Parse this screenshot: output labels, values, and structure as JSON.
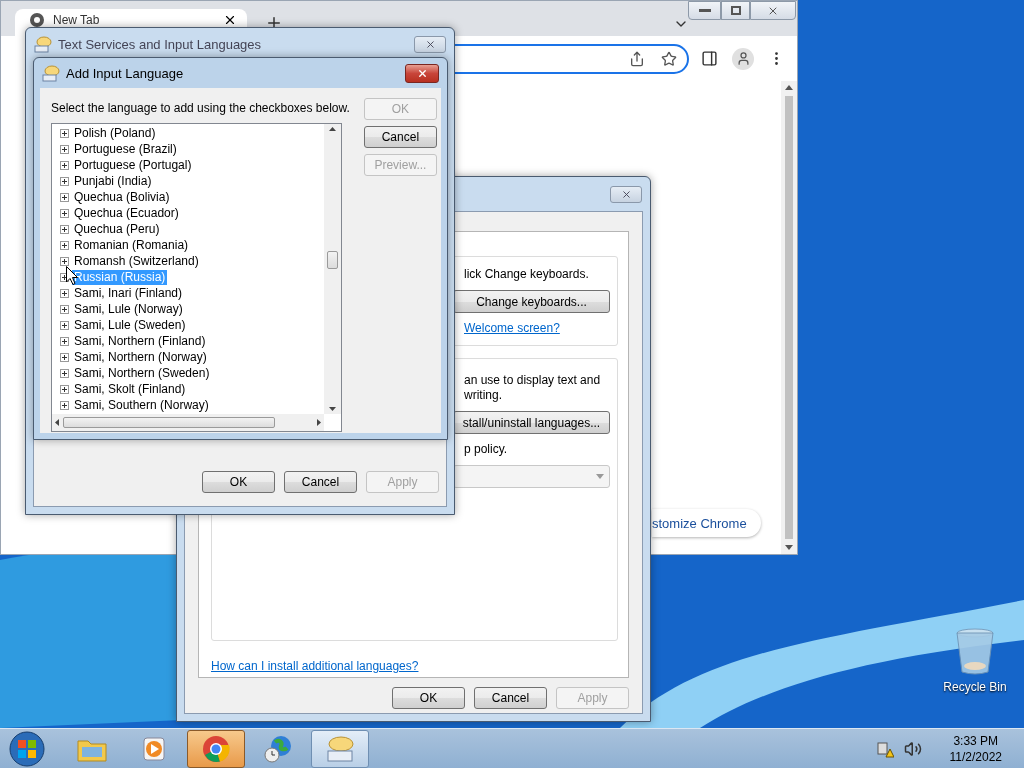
{
  "browser": {
    "tab": {
      "label": "New Tab",
      "selected": true
    },
    "customize_button": "stomize Chrome"
  },
  "language_dialog": {
    "keyboards_text": "lick Change keyboards.",
    "change_keyboards_button": "Change keyboards...",
    "welcome_link": "Welcome screen?",
    "display_text": "an use to display text and\nwriting.",
    "install_button": "stall/uninstall languages...",
    "policy_text": "p policy.",
    "help_link": "How can I install additional languages?",
    "buttons": [
      {
        "label": "OK",
        "disabled": false
      },
      {
        "label": "Cancel",
        "disabled": false
      },
      {
        "label": "Apply",
        "disabled": true
      }
    ]
  },
  "text_services_dialog": {
    "title": "Text Services and Input Languages",
    "buttons": [
      {
        "label": "OK",
        "disabled": false
      },
      {
        "label": "Cancel",
        "disabled": false
      },
      {
        "label": "Apply",
        "disabled": true
      }
    ]
  },
  "add_language_dialog": {
    "title": "Add Input Language",
    "instruction": "Select the language to add using the checkboxes below.",
    "buttons": [
      {
        "label": "OK",
        "disabled": true
      },
      {
        "label": "Cancel",
        "disabled": false
      },
      {
        "label": "Preview...",
        "disabled": true
      }
    ],
    "languages": [
      {
        "label": "Polish (Poland)",
        "selected": false,
        "expanded": false
      },
      {
        "label": "Portuguese (Brazil)",
        "selected": false,
        "expanded": false
      },
      {
        "label": "Portuguese (Portugal)",
        "selected": false,
        "expanded": false
      },
      {
        "label": "Punjabi (India)",
        "selected": false,
        "expanded": false
      },
      {
        "label": "Quechua (Bolivia)",
        "selected": false,
        "expanded": false
      },
      {
        "label": "Quechua (Ecuador)",
        "selected": false,
        "expanded": false
      },
      {
        "label": "Quechua (Peru)",
        "selected": false,
        "expanded": false
      },
      {
        "label": "Romanian (Romania)",
        "selected": false,
        "expanded": false
      },
      {
        "label": "Romansh (Switzerland)",
        "selected": false,
        "expanded": false
      },
      {
        "label": "Russian (Russia)",
        "selected": true,
        "expanded": false
      },
      {
        "label": "Sami, Inari (Finland)",
        "selected": false,
        "expanded": false
      },
      {
        "label": "Sami, Lule (Norway)",
        "selected": false,
        "expanded": false
      },
      {
        "label": "Sami, Lule (Sweden)",
        "selected": false,
        "expanded": false
      },
      {
        "label": "Sami, Northern (Finland)",
        "selected": false,
        "expanded": false
      },
      {
        "label": "Sami, Northern (Norway)",
        "selected": false,
        "expanded": false
      },
      {
        "label": "Sami, Northern (Sweden)",
        "selected": false,
        "expanded": false
      },
      {
        "label": "Sami, Skolt (Finland)",
        "selected": false,
        "expanded": false
      },
      {
        "label": "Sami, Southern (Norway)",
        "selected": false,
        "expanded": false
      }
    ]
  },
  "desktop_icons": [
    {
      "label": "Recycle Bin"
    }
  ],
  "taskbar": {
    "apps": [
      {
        "kind": "explorer",
        "flashing": false,
        "active": false
      },
      {
        "kind": "media",
        "flashing": false,
        "active": false
      },
      {
        "kind": "chrome",
        "flashing": true,
        "active": false
      },
      {
        "kind": "globe",
        "flashing": false,
        "active": false
      },
      {
        "kind": "keyboard",
        "flashing": false,
        "active": true
      }
    ],
    "clock": {
      "time": "3:33 PM",
      "date": "11/2/2022"
    }
  }
}
